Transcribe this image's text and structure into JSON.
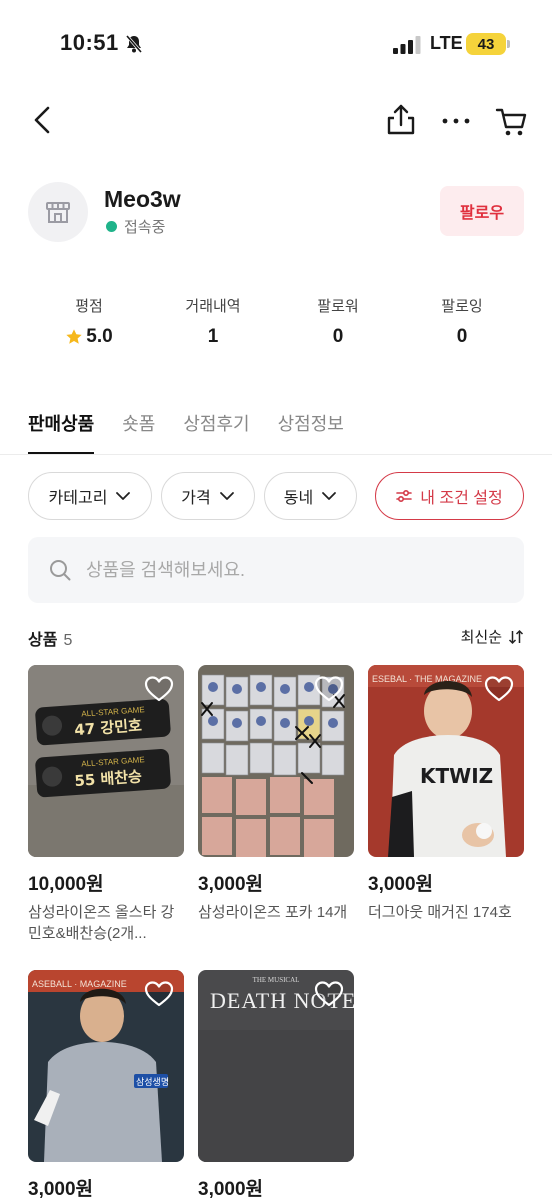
{
  "status_bar": {
    "time": "10:51",
    "network": "LTE",
    "battery": "43"
  },
  "profile": {
    "name": "Meo3w",
    "status": "접속중",
    "follow_label": "팔로우"
  },
  "stats": [
    {
      "label": "평점",
      "value": "5.0"
    },
    {
      "label": "거래내역",
      "value": "1"
    },
    {
      "label": "팔로워",
      "value": "0"
    },
    {
      "label": "팔로잉",
      "value": "0"
    }
  ],
  "tabs": [
    {
      "label": "판매상품",
      "active": true
    },
    {
      "label": "숏폼",
      "active": false
    },
    {
      "label": "상점후기",
      "active": false
    },
    {
      "label": "상점정보",
      "active": false
    }
  ],
  "filters": {
    "category": "카테고리",
    "price": "가격",
    "neighborhood": "동네",
    "my_conditions": "내 조건 설정"
  },
  "search": {
    "placeholder": "상품을 검색해보세요."
  },
  "products_header": {
    "title": "상품",
    "count": "5",
    "sort": "최신순"
  },
  "products": [
    {
      "price": "10,000원",
      "name": "삼성라이온즈 올스타 강민호&배찬승(2개...",
      "image_texts": [
        "47 강민호",
        "55 배찬승"
      ]
    },
    {
      "price": "3,000원",
      "name": "삼성라이온즈 포카 14개",
      "image_texts": []
    },
    {
      "price": "3,000원",
      "name": "더그아웃 매거진 174호",
      "image_texts": [
        "KTWIZ"
      ]
    },
    {
      "price": "3,000원",
      "name": "",
      "image_texts": [
        "삼성생명"
      ]
    },
    {
      "price": "3,000원",
      "name": "",
      "image_texts": [
        "THE MUSICAL",
        "DEATH NOTE"
      ]
    }
  ],
  "colors": {
    "accent": "#e0303e",
    "online": "#1fb38a",
    "star": "#f6b81c",
    "battery": "#f5d33b"
  }
}
